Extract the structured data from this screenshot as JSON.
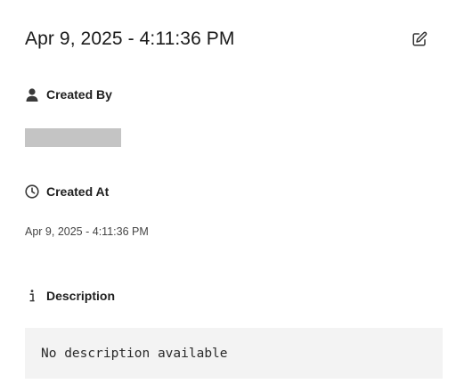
{
  "header": {
    "title": "Apr 9, 2025 - 4:11:36 PM",
    "edit_icon": "edit-icon"
  },
  "created_by": {
    "label": "Created By",
    "icon": "person-icon",
    "value_redacted": true
  },
  "created_at": {
    "label": "Created At",
    "icon": "clock-icon",
    "value": "Apr 9, 2025 - 4:11:36 PM"
  },
  "description": {
    "label": "Description",
    "icon": "info-icon",
    "value": "No description available"
  },
  "colors": {
    "redacted_block": "#c4c4c4",
    "description_box": "#f3f3f3",
    "text": "#1f1f1f"
  }
}
